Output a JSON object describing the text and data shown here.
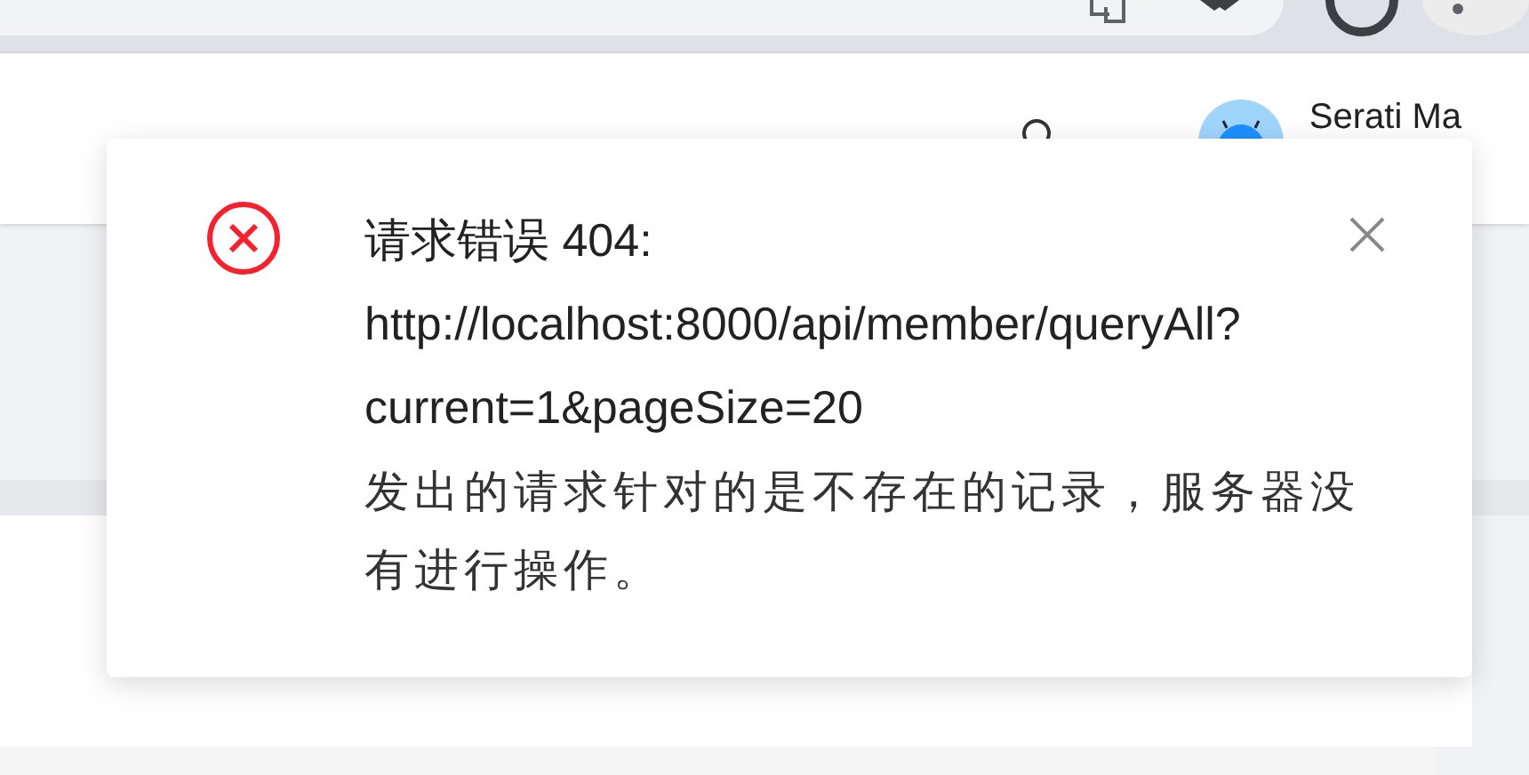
{
  "header": {
    "user_name": "Serati Ma"
  },
  "notification": {
    "title": "请求错误 404: http://localhost:8000/api/member/queryAll?current=1&pageSize=20",
    "description": "发出的请求针对的是不存在的记录，服务器没有进行操作。"
  }
}
